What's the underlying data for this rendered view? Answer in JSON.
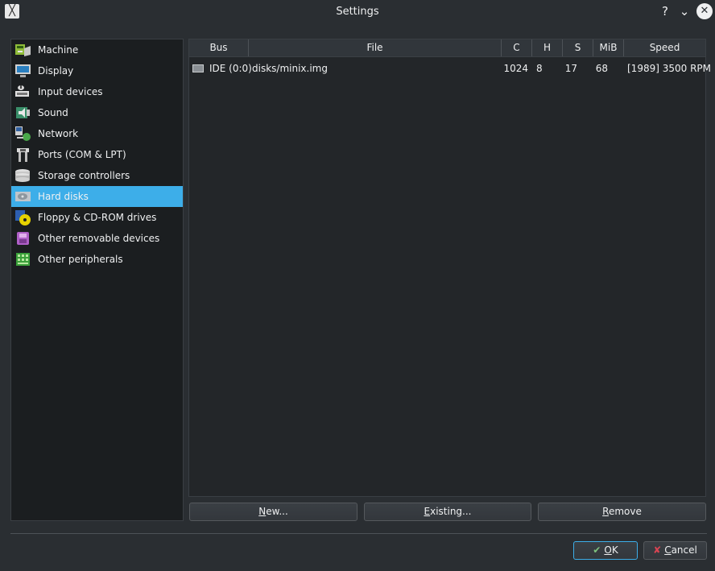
{
  "window": {
    "title": "Settings",
    "help_glyph": "?",
    "minimize_glyph": "⌄",
    "close_glyph": "✕"
  },
  "sidebar": {
    "items": [
      {
        "label": "Machine",
        "icon": "machine-icon"
      },
      {
        "label": "Display",
        "icon": "display-icon"
      },
      {
        "label": "Input devices",
        "icon": "input-devices-icon"
      },
      {
        "label": "Sound",
        "icon": "sound-icon"
      },
      {
        "label": "Network",
        "icon": "network-icon"
      },
      {
        "label": "Ports (COM & LPT)",
        "icon": "ports-icon"
      },
      {
        "label": "Storage controllers",
        "icon": "storage-controllers-icon"
      },
      {
        "label": "Hard disks",
        "icon": "hard-disk-icon",
        "selected": true
      },
      {
        "label": "Floppy & CD-ROM drives",
        "icon": "floppy-cdrom-icon"
      },
      {
        "label": "Other removable devices",
        "icon": "removable-devices-icon"
      },
      {
        "label": "Other peripherals",
        "icon": "peripherals-icon"
      }
    ]
  },
  "disks_table": {
    "columns": [
      "Bus",
      "File",
      "C",
      "H",
      "S",
      "MiB",
      "Speed"
    ],
    "rows": [
      {
        "bus": "IDE (0:0)",
        "file": "disks/minix.img",
        "c": "1024",
        "h": "8",
        "s": "17",
        "mib": "68",
        "speed": "[1989] 3500 RPM"
      }
    ]
  },
  "buttons": {
    "new": {
      "mnemonic": "N",
      "rest": "ew..."
    },
    "existing": {
      "mnemonic": "E",
      "rest": "xisting..."
    },
    "remove": {
      "mnemonic": "R",
      "rest": "emove"
    },
    "ok": {
      "mnemonic": "O",
      "rest": "K"
    },
    "cancel": {
      "mnemonic": "C",
      "rest": "ancel"
    }
  },
  "colors": {
    "accent": "#3daee9",
    "background": "#2a2e32",
    "panel": "#1b1e20"
  }
}
